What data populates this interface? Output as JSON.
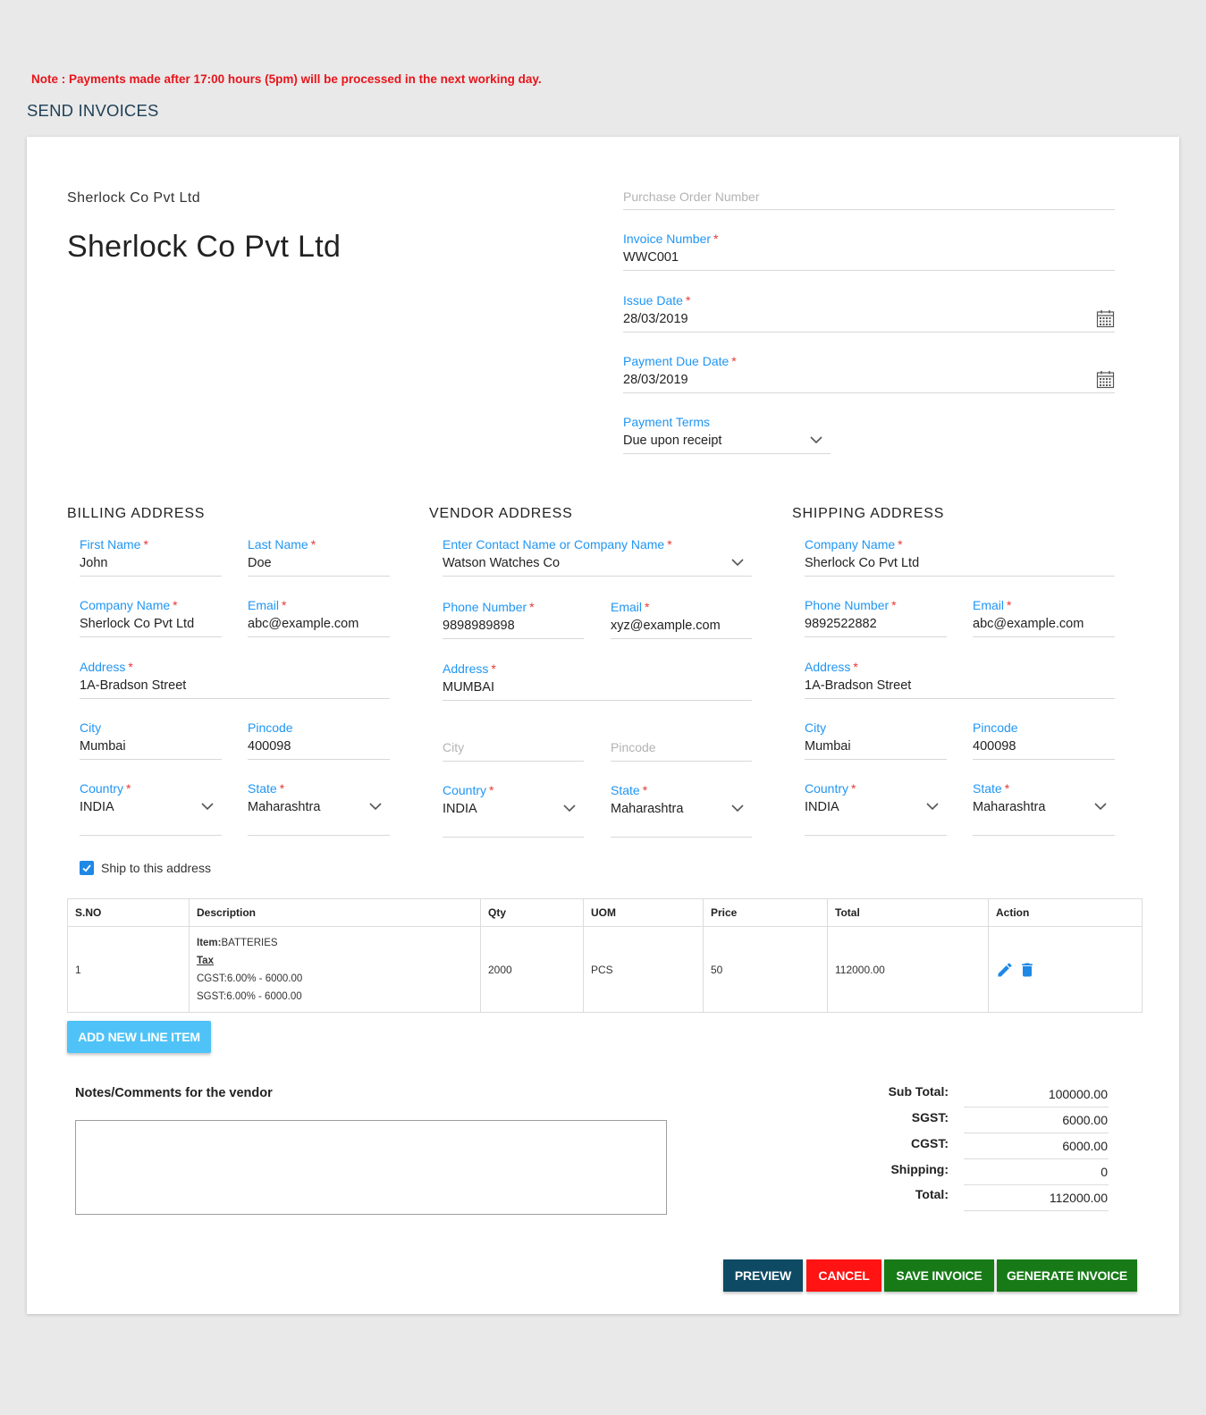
{
  "note": "Note : Payments made after 17:00 hours (5pm) will be processed in the next working day.",
  "page_title": "SEND INVOICES",
  "company": {
    "small": "Sherlock Co Pvt Ltd",
    "big": "Sherlock Co Pvt Ltd"
  },
  "invoice": {
    "po_placeholder": "Purchase Order Number",
    "invoice_number_label": "Invoice Number",
    "invoice_number": "WWC001",
    "issue_date_label": "Issue Date",
    "issue_date": "28/03/2019",
    "due_date_label": "Payment Due Date",
    "due_date": "28/03/2019",
    "terms_label": "Payment Terms",
    "terms": "Due upon receipt"
  },
  "billing": {
    "title": "BILLING ADDRESS",
    "first_name_label": "First Name",
    "first_name": "John",
    "last_name_label": "Last Name",
    "last_name": "Doe",
    "company_label": "Company Name",
    "company": "Sherlock Co Pvt Ltd",
    "email_label": "Email",
    "email": "abc@example.com",
    "address_label": "Address",
    "address": "1A-Bradson Street",
    "city_label": "City",
    "city": "Mumbai",
    "pincode_label": "Pincode",
    "pincode": "400098",
    "country_label": "Country",
    "country": "INDIA",
    "state_label": "State",
    "state": "Maharashtra"
  },
  "vendor": {
    "title": "VENDOR ADDRESS",
    "contact_label": "Enter Contact Name or Company Name",
    "contact": "Watson Watches Co",
    "phone_label": "Phone Number",
    "phone": "9898989898",
    "email_label": "Email",
    "email": "xyz@example.com",
    "address_label": "Address",
    "address": "MUMBAI",
    "city_placeholder": "City",
    "pincode_placeholder": "Pincode",
    "country_label": "Country",
    "country": "INDIA",
    "state_label": "State",
    "state": "Maharashtra"
  },
  "shipping": {
    "title": "SHIPPING ADDRESS",
    "company_label": "Company Name",
    "company": "Sherlock Co Pvt Ltd",
    "phone_label": "Phone Number",
    "phone": "9892522882",
    "email_label": "Email",
    "email": "abc@example.com",
    "address_label": "Address",
    "address": "1A-Bradson Street",
    "city_label": "City",
    "city": "Mumbai",
    "pincode_label": "Pincode",
    "pincode": "400098",
    "country_label": "Country",
    "country": "INDIA",
    "state_label": "State",
    "state": "Maharashtra"
  },
  "ship_to_label": "Ship to this address",
  "ship_to_checked": true,
  "table": {
    "headers": [
      "S.NO",
      "Description",
      "Qty",
      "UOM",
      "Price",
      "Total",
      "Action"
    ],
    "rows": [
      {
        "sno": "1",
        "item_label": "Item:",
        "item": "BATTERIES",
        "tax_label": "Tax",
        "cgst": "CGST:6.00% - 6000.00",
        "sgst": "SGST:6.00% - 6000.00",
        "qty": "2000",
        "uom": "PCS",
        "price": "50",
        "total": "112000.00"
      }
    ]
  },
  "add_line_label": "ADD NEW LINE ITEM",
  "notes_label": "Notes/Comments for the vendor",
  "totals": {
    "subtotal_label": "Sub Total:",
    "subtotal": "100000.00",
    "sgst_label": "SGST:",
    "sgst": "6000.00",
    "cgst_label": "CGST:",
    "cgst": "6000.00",
    "shipping_label": "Shipping:",
    "shipping": "0",
    "total_label": "Total:",
    "total": "112000.00"
  },
  "buttons": {
    "preview": "PREVIEW",
    "cancel": "CANCEL",
    "save": "SAVE INVOICE",
    "generate": "GENERATE INVOICE"
  },
  "colors": {
    "accent_blue": "#2196f3",
    "required_red": "#e53935",
    "preview": "#0e4a64",
    "cancel": "#ff1313",
    "save": "#177a17",
    "add_line": "#4fc3f7"
  }
}
